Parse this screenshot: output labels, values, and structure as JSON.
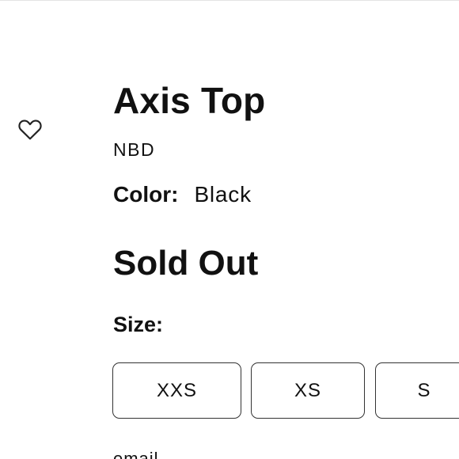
{
  "product": {
    "title": "Axis Top",
    "vendor": "NBD",
    "color_label": "Color:",
    "color_value": "Black",
    "availability": "Sold Out",
    "size_label": "Size:",
    "sizes": [
      "XXS",
      "XS",
      "S"
    ],
    "email_label": "email"
  },
  "icons": {
    "wishlist": "heart-outline-icon"
  }
}
